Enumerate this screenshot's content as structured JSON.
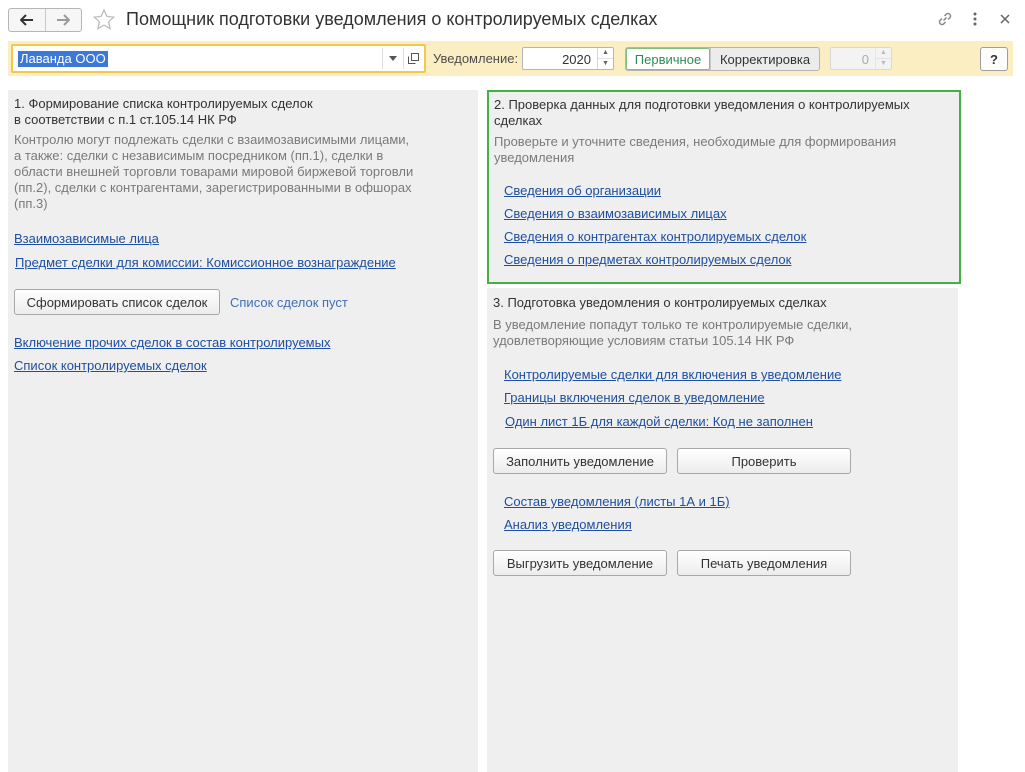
{
  "window": {
    "title": "Помощник подготовки уведомления о контролируемых сделках"
  },
  "toolbar": {
    "organization": "Лаванда ООО",
    "notice_label": "Уведомление:",
    "year": "2020",
    "mode_primary": "Первичное",
    "mode_correction": "Корректировка",
    "correction_number": "0",
    "help_label": "?"
  },
  "section1": {
    "title_line1": "1. Формирование списка контролируемых сделок",
    "title_line2": "в соответствии с п.1 ст.105.14 НК РФ",
    "desc": [
      "Контролю могут подлежать сделки с взаимозависимыми лицами,",
      "а также: сделки с независимым посредником (пп.1), сделки в",
      "области внешней торговли товарами мировой биржевой торговли",
      "(пп.2), сделки с контрагентами, зарегистрированными в офшорах",
      "(пп.3)"
    ],
    "link_related": "Взаимозависимые лица",
    "link_commission": "Предмет сделки для комиссии: Комиссионное вознаграждение",
    "btn_generate": "Сформировать список сделок",
    "list_status": "Список сделок пуст",
    "link_include_other": "Включение прочих сделок в состав контролируемых",
    "link_list": "Список контролируемых сделок"
  },
  "section2": {
    "title_line1": "2. Проверка данных для подготовки уведомления о контролируемых",
    "title_line2": "сделках",
    "desc_line1": "Проверьте и уточните сведения, необходимые для формирования",
    "desc_line2": "уведомления",
    "link_org": "Сведения об организации",
    "link_related": "Сведения о взаимозависимых лицах",
    "link_counterparties": "Сведения о контрагентах контролируемых сделок",
    "link_subjects": "Сведения о предметах контролируемых сделок"
  },
  "section3": {
    "title": "3. Подготовка уведомления о контролируемых сделках",
    "desc_line1": "В уведомление попадут только те контролируемые сделки,",
    "desc_line2": "удовлетворяющие условиям статьи 105.14 НК РФ",
    "link_include": "Контролируемые сделки для включения в уведомление",
    "link_bounds": "Границы включения сделок в уведомление",
    "link_one_sheet": "Один лист 1Б для каждой сделки: Код не заполнен",
    "btn_fill": "Заполнить уведомление",
    "btn_check": "Проверить",
    "link_composition": "Состав уведомления (листы 1А и 1Б)",
    "link_analysis": "Анализ уведомления",
    "btn_export": "Выгрузить уведомление",
    "btn_print": "Печать уведомления"
  }
}
